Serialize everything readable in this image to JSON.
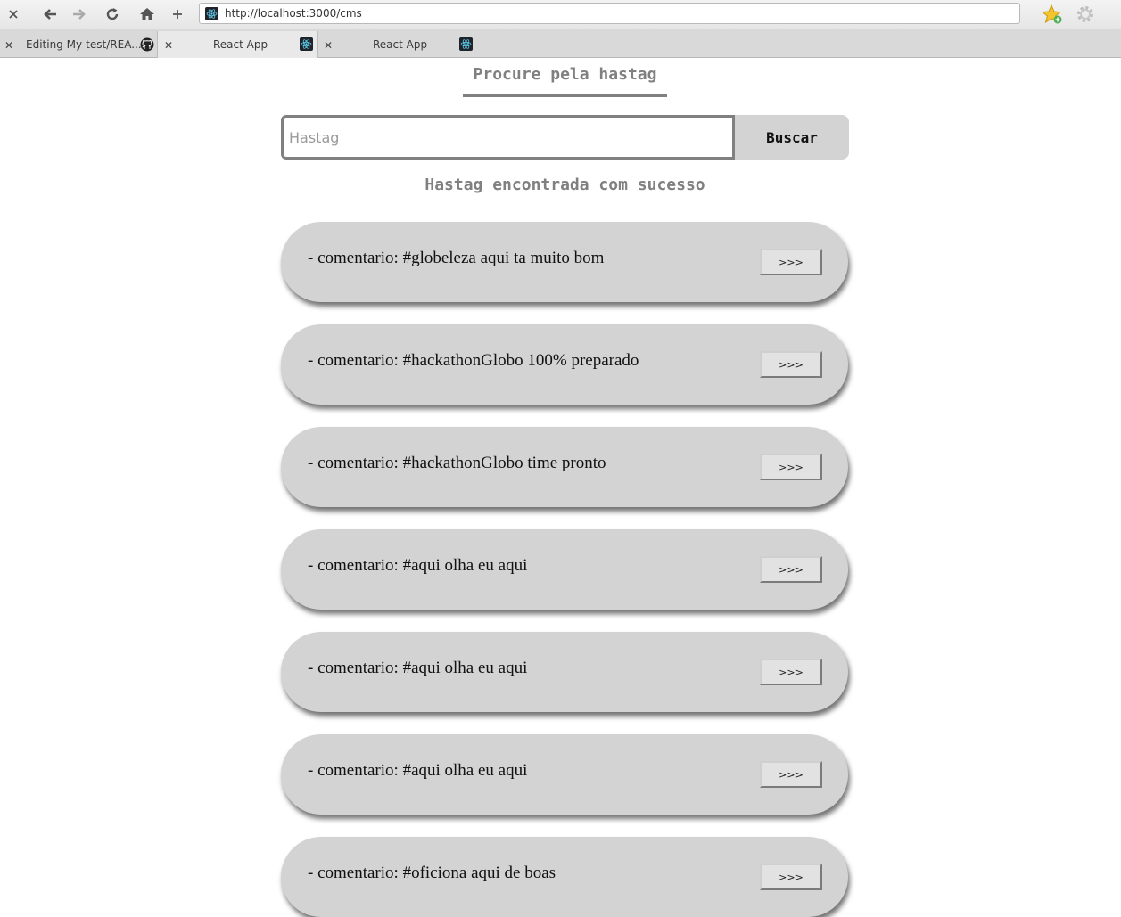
{
  "browser": {
    "url": "http://localhost:3000/cms",
    "tabs": [
      {
        "title": "Editing My-test/REA...",
        "icon": "github-icon"
      },
      {
        "title": "React App",
        "icon": "react-icon"
      },
      {
        "title": "React App",
        "icon": "react-icon"
      }
    ]
  },
  "page": {
    "title": "Procure pela hastag",
    "search": {
      "placeholder": "Hastag",
      "value": "",
      "button_label": "Buscar"
    },
    "status": "Hastag encontrada com sucesso",
    "comments": [
      {
        "text": "- comentario: #globeleza aqui ta muito bom",
        "button_label": ">>>"
      },
      {
        "text": "- comentario: #hackathonGlobo 100% preparado",
        "button_label": ">>>"
      },
      {
        "text": "- comentario: #hackathonGlobo time pronto",
        "button_label": ">>>"
      },
      {
        "text": "- comentario: #aqui olha eu aqui",
        "button_label": ">>>"
      },
      {
        "text": "- comentario: #aqui olha eu aqui",
        "button_label": ">>>"
      },
      {
        "text": "- comentario: #aqui olha eu aqui",
        "button_label": ">>>"
      },
      {
        "text": "- comentario: #oficiona aqui de boas",
        "button_label": ">>>"
      }
    ]
  },
  "colors": {
    "accent_gray": "#808080",
    "card_bg": "#d3d3d3",
    "react_icon": "#61dafb"
  }
}
